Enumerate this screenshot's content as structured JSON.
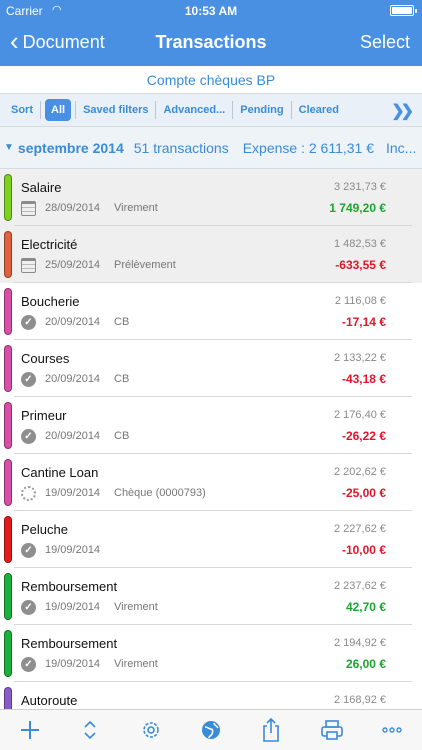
{
  "status": {
    "carrier": "Carrier",
    "time": "10:53 AM"
  },
  "nav": {
    "back_label": "Document",
    "title": "Transactions",
    "select_label": "Select"
  },
  "account": "Compte chèques BP",
  "filters": [
    "Sort",
    "All",
    "Saved filters",
    "Advanced...",
    "Pending",
    "Cleared"
  ],
  "month": {
    "name": "septembre 2014",
    "count": "51 transactions",
    "expense": "Expense : 2 611,31 €",
    "income_truncated": "Inc..."
  },
  "colors": {
    "accent": "#4a90e2",
    "positive": "#1aa531",
    "negative": "#e0162b"
  },
  "transactions": [
    {
      "name": "Salaire",
      "date": "28/09/2014",
      "method": "Virement",
      "balance": "3 231,73 €",
      "amount": "1 749,20 €",
      "sign": "pos",
      "status_icon": "calendar-icon",
      "color": "#7fd11f"
    },
    {
      "name": "Electricité",
      "date": "25/09/2014",
      "method": "Prélèvement",
      "balance": "1 482,53 €",
      "amount": "-633,55 €",
      "sign": "neg",
      "status_icon": "calendar-icon",
      "color": "#e0613f"
    },
    {
      "name": "Boucherie",
      "date": "20/09/2014",
      "method": "CB",
      "balance": "2 116,08 €",
      "amount": "-17,14 €",
      "sign": "neg",
      "status_icon": "check-icon",
      "color": "#d94ea8"
    },
    {
      "name": "Courses",
      "date": "20/09/2014",
      "method": "CB",
      "balance": "2 133,22 €",
      "amount": "-43,18 €",
      "sign": "neg",
      "status_icon": "check-icon",
      "color": "#d94ea8"
    },
    {
      "name": "Primeur",
      "date": "20/09/2014",
      "method": "CB",
      "balance": "2 176,40 €",
      "amount": "-26,22 €",
      "sign": "neg",
      "status_icon": "check-icon",
      "color": "#d94ea8"
    },
    {
      "name": "Cantine Loan",
      "date": "19/09/2014",
      "method": "Chèque (0000793)",
      "balance": "2 202,62 €",
      "amount": "-25,00 €",
      "sign": "neg",
      "status_icon": "pending-spinner-icon",
      "color": "#d94ea8"
    },
    {
      "name": "Peluche",
      "date": "19/09/2014",
      "method": "",
      "balance": "2 227,62 €",
      "amount": "-10,00 €",
      "sign": "neg",
      "status_icon": "check-icon",
      "color": "#e31b1b"
    },
    {
      "name": "Remboursement",
      "date": "19/09/2014",
      "method": "Virement",
      "balance": "2 237,62 €",
      "amount": "42,70 €",
      "sign": "pos",
      "status_icon": "check-icon",
      "color": "#1bb13a"
    },
    {
      "name": "Remboursement",
      "date": "19/09/2014",
      "method": "Virement",
      "balance": "2 194,92 €",
      "amount": "26,00 €",
      "sign": "pos",
      "status_icon": "check-icon",
      "color": "#1bb13a"
    },
    {
      "name": "Autoroute",
      "date": "",
      "method": "",
      "balance": "2 168,92 €",
      "amount": "",
      "sign": "neg",
      "status_icon": "",
      "color": "#8a5cc9"
    }
  ],
  "toolbar": [
    "add-icon",
    "reorder-icon",
    "settings-icon",
    "globe-icon",
    "share-icon",
    "print-icon",
    "more-icon"
  ]
}
